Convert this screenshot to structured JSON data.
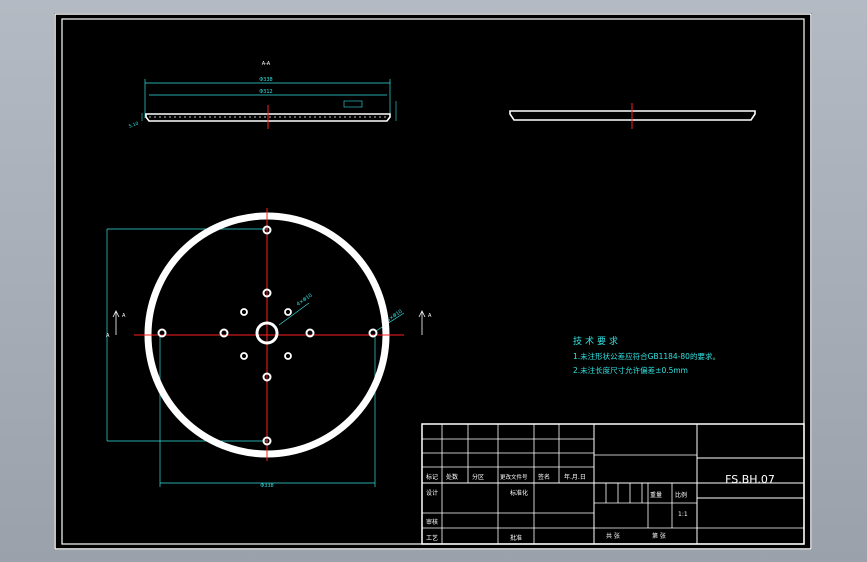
{
  "drawing": {
    "title_note": "技术要求",
    "notes": [
      "1.未注形状公差应符合GB1184-80的要求。",
      "2.未注长度尺寸允许偏差±0.5mm"
    ],
    "dimensions": {
      "top_overall": "Φ338",
      "top_inner": "Φ312",
      "bottom_width": "Φ338",
      "hole_small": "4×Φ10",
      "hole_large": "6×Φ10",
      "section_mark": "A",
      "view_label": "A-A"
    }
  },
  "title_block": {
    "drawing_no": "FS.BH.07",
    "row_labels": [
      "标记",
      "处数",
      "分区",
      "更改文件号",
      "签名",
      "年.月.日"
    ],
    "design": "设计",
    "standardize": "标准化",
    "review": "审核",
    "craft": "工艺",
    "approve": "批准",
    "weight_label": "重量",
    "scale_label": "比例",
    "scale": "1:1",
    "sheets_total": "共  张",
    "sheet_no": "第  张"
  }
}
